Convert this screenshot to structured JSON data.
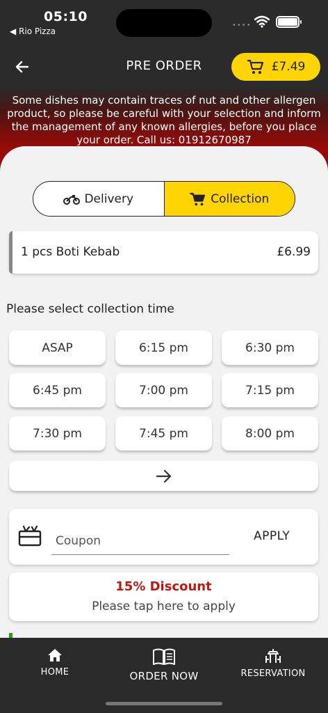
{
  "status_bar": {
    "time": "05:10",
    "back_app": "◀ Rio Pizza",
    "signal": "••••"
  },
  "header": {
    "title": "PRE ORDER",
    "cart_total": "£7.49"
  },
  "allergen_notice": "Some dishes may contain traces of nut and other allergen product, so please be careful with your selection and inform the management of any known allergies, before you place your order. Call us: 01912670987",
  "order_type": {
    "options": [
      "Delivery",
      "Collection"
    ],
    "selected": "Collection"
  },
  "order_item": {
    "name": "1 pcs Boti Kebab",
    "price": "£6.99"
  },
  "collection": {
    "label": "Please select collection time",
    "slots": [
      "ASAP",
      "6:15 pm",
      "6:30 pm",
      "6:45 pm",
      "7:00 pm",
      "7:15 pm",
      "7:30 pm",
      "7:45 pm",
      "8:00 pm"
    ]
  },
  "coupon": {
    "placeholder": "Coupon",
    "apply_label": "APPLY"
  },
  "discount": {
    "title": "15% Discount",
    "subtitle": "Please tap here to apply"
  },
  "tabbar": {
    "items": [
      "HOME",
      "ORDER NOW",
      "RESERVATION"
    ]
  },
  "colors": {
    "accent": "#ffd400",
    "discount_red": "#c4150f",
    "dark": "#2a2a2a"
  }
}
